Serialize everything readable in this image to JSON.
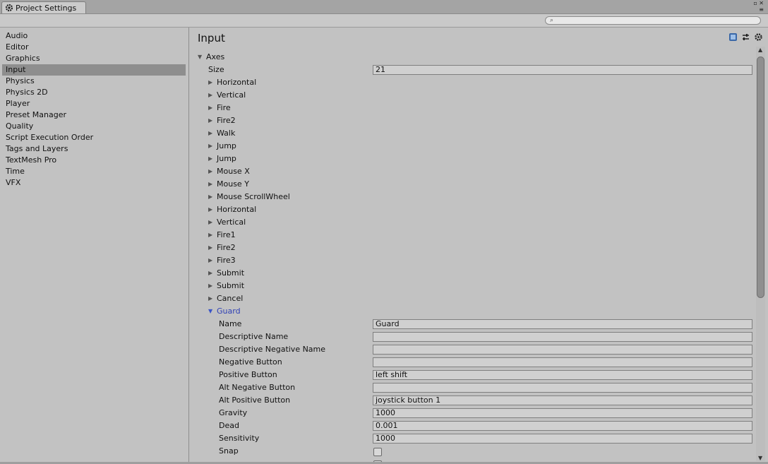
{
  "window": {
    "tab_title": "Project Settings",
    "tab_icon": "gear-icon"
  },
  "search": {
    "value": "",
    "placeholder": ""
  },
  "sidebar": {
    "items": [
      {
        "label": "Audio"
      },
      {
        "label": "Editor"
      },
      {
        "label": "Graphics"
      },
      {
        "label": "Input"
      },
      {
        "label": "Physics"
      },
      {
        "label": "Physics 2D"
      },
      {
        "label": "Player"
      },
      {
        "label": "Preset Manager"
      },
      {
        "label": "Quality"
      },
      {
        "label": "Script Execution Order"
      },
      {
        "label": "Tags and Layers"
      },
      {
        "label": "TextMesh Pro"
      },
      {
        "label": "Time"
      },
      {
        "label": "VFX"
      }
    ],
    "active": "Input"
  },
  "main": {
    "title": "Input",
    "axes_label": "Axes",
    "size_label": "Size",
    "size_value": "21",
    "axes": [
      "Horizontal",
      "Vertical",
      "Fire",
      "Fire2",
      "Walk",
      "Jump",
      "Jump",
      "Mouse X",
      "Mouse Y",
      "Mouse ScrollWheel",
      "Horizontal",
      "Vertical",
      "Fire1",
      "Fire2",
      "Fire3",
      "Submit",
      "Submit",
      "Cancel"
    ],
    "expanded_axis": "Guard",
    "fields": [
      {
        "label": "Name",
        "value": "Guard"
      },
      {
        "label": "Descriptive Name",
        "value": ""
      },
      {
        "label": "Descriptive Negative Name",
        "value": ""
      },
      {
        "label": "Negative Button",
        "value": ""
      },
      {
        "label": "Positive Button",
        "value": "left shift"
      },
      {
        "label": "Alt Negative Button",
        "value": ""
      },
      {
        "label": "Alt Positive Button",
        "value": "joystick button 1"
      },
      {
        "label": "Gravity",
        "value": "1000"
      },
      {
        "label": "Dead",
        "value": "0.001"
      },
      {
        "label": "Sensitivity",
        "value": "1000"
      }
    ],
    "snap_label": "Snap",
    "snap_checked": false
  },
  "colors": {
    "active_row": "#8e8e8e",
    "expanded_label": "#3041b5",
    "background": "#c2c2c2"
  }
}
